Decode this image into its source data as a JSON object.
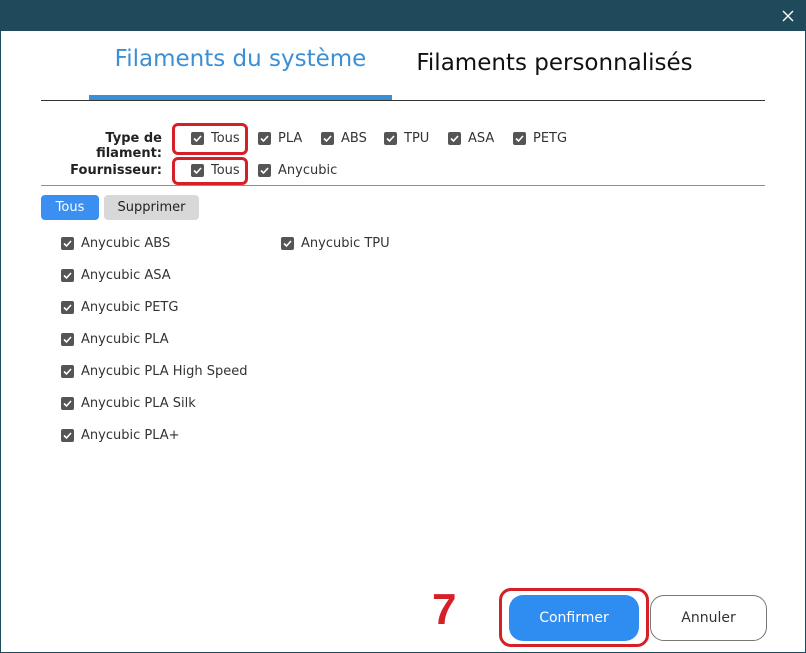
{
  "window": {
    "close_label": "×"
  },
  "tabs": [
    {
      "label": "Filaments du système",
      "active": true
    },
    {
      "label": "Filaments personnalisés",
      "active": false
    }
  ],
  "filters": {
    "type_label": "Type de filament:",
    "type_options": [
      {
        "label": "Tous",
        "checked": true
      },
      {
        "label": "PLA",
        "checked": true
      },
      {
        "label": "ABS",
        "checked": true
      },
      {
        "label": "TPU",
        "checked": true
      },
      {
        "label": "ASA",
        "checked": true
      },
      {
        "label": "PETG",
        "checked": true
      }
    ],
    "vendor_label": "Fournisseur:",
    "vendor_options": [
      {
        "label": "Tous",
        "checked": true
      },
      {
        "label": "Anycubic",
        "checked": true
      }
    ]
  },
  "actions": {
    "all_label": "Tous",
    "delete_label": "Supprimer"
  },
  "filaments": [
    {
      "label": "Anycubic ABS",
      "checked": true
    },
    {
      "label": "Anycubic ASA",
      "checked": true
    },
    {
      "label": "Anycubic PETG",
      "checked": true
    },
    {
      "label": "Anycubic PLA",
      "checked": true
    },
    {
      "label": "Anycubic PLA High Speed",
      "checked": true
    },
    {
      "label": "Anycubic PLA Silk",
      "checked": true
    },
    {
      "label": "Anycubic PLA+",
      "checked": true
    },
    {
      "label": "Anycubic TPU",
      "checked": true
    }
  ],
  "annotation": {
    "step_number": "7",
    "highlight_color": "#d62028"
  },
  "footer": {
    "confirm_label": "Confirmer",
    "cancel_label": "Annuler"
  },
  "colors": {
    "accent": "#3b8fd5",
    "titlebar": "#1f4a5c",
    "confirm": "#2f8cf0"
  }
}
